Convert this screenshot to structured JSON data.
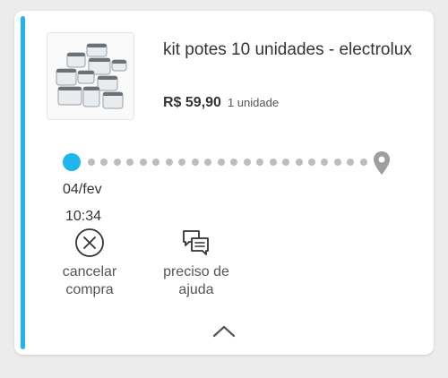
{
  "order": {
    "product_title": "kit potes 10 unidades - electrolux",
    "price": "R$ 59,90",
    "quantity": "1 unidade",
    "image_icon": "food-container-set-image"
  },
  "tracking": {
    "date": "04/fev",
    "time": "10:34",
    "start_color": "#1fb6ee",
    "destination_icon": "map-pin-icon"
  },
  "actions": {
    "cancel_line1": "cancelar",
    "cancel_line2": "compra",
    "cancel_icon": "circle-x-icon",
    "help_line1": "preciso de",
    "help_line2": "ajuda",
    "help_icon": "chat-bubbles-icon"
  },
  "footer": {
    "collapse_icon": "chevron-up-icon"
  },
  "colors": {
    "accent": "#1fb6ee",
    "text": "#333333",
    "muted": "#bdbdbd"
  }
}
